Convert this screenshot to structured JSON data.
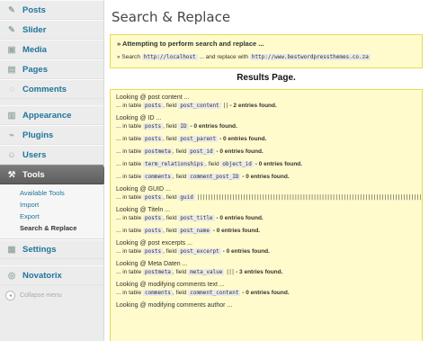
{
  "sidebar": {
    "items_top": [
      {
        "label": "Posts",
        "icon": "pin-icon"
      },
      {
        "label": "Slider",
        "icon": "pin-icon"
      },
      {
        "label": "Media",
        "icon": "media-icon"
      },
      {
        "label": "Pages",
        "icon": "page-icon"
      },
      {
        "label": "Comments",
        "icon": "comment-icon"
      }
    ],
    "items_mid": [
      {
        "label": "Appearance",
        "icon": "appearance-icon"
      },
      {
        "label": "Plugins",
        "icon": "plugin-icon"
      },
      {
        "label": "Users",
        "icon": "users-icon"
      }
    ],
    "tools": {
      "label": "Tools",
      "icon": "wrench-icon"
    },
    "submenu": [
      "Available Tools",
      "Import",
      "Export",
      "Search & Replace"
    ],
    "items_bottom": [
      {
        "label": "Settings",
        "icon": "settings-icon"
      }
    ],
    "items_last": [
      {
        "label": "Novatorix",
        "icon": "novatorix-icon"
      }
    ],
    "collapse_label": "Collapse menu"
  },
  "main": {
    "title": "Search & Replace",
    "attempt": {
      "heading": "» Attempting to perform search and replace ...",
      "search_prefix": "» Search",
      "search_value": "http://localhost",
      "replace_prefix": "... and replace with",
      "replace_value": "http://www.bestwordpressthemes.co.za"
    },
    "results_title": "Results Page.",
    "groups": [
      {
        "label": "Looking @ post content ...",
        "lines": [
          {
            "table": "posts",
            "field": "post_content",
            "bars": "||",
            "count": "- 2 entries found."
          }
        ]
      },
      {
        "label": "Looking @ ID ...",
        "lines": [
          {
            "table": "posts",
            "field": "ID",
            "bars": "",
            "count": "- 0 entries found."
          },
          {
            "table": "posts",
            "field": "post_parent",
            "bars": "",
            "count": "- 0 entries found."
          },
          {
            "table": "postmeta",
            "field": "post_id",
            "bars": "",
            "count": "- 0 entries found."
          },
          {
            "table": "term_relationships",
            "field": "object_id",
            "bars": "",
            "count": "- 0 entries found."
          },
          {
            "table": "comments",
            "field": "comment_post_ID",
            "bars": "",
            "count": "- 0 entries found."
          }
        ]
      },
      {
        "label": "Looking @ GUID ...",
        "lines": [
          {
            "table": "posts",
            "field": "guid",
            "bars": "||||||||||||||||||||||||||||||||||||||||||||||||||||||||||||||||||||||||||||||||||||||||||",
            "count": ""
          }
        ]
      },
      {
        "label": "Looking @ Titeln ...",
        "lines": [
          {
            "table": "posts",
            "field": "post_title",
            "bars": "",
            "count": "- 0 entries found."
          },
          {
            "table": "posts",
            "field": "post_name",
            "bars": "",
            "count": "- 0 entries found."
          }
        ]
      },
      {
        "label": "Looking @ post excerpts ...",
        "lines": [
          {
            "table": "posts",
            "field": "post_excerpt",
            "bars": "",
            "count": "- 0 entries found."
          }
        ]
      },
      {
        "label": "Looking @ Meta Daten ...",
        "lines": [
          {
            "table": "postmeta",
            "field": "meta_value",
            "bars": "|||",
            "count": "- 3 entries found."
          }
        ]
      },
      {
        "label": "Looking @ modifying comments text ...",
        "lines": [
          {
            "table": "comments",
            "field": "comment_content",
            "bars": "",
            "count": "- 0 entries found."
          }
        ]
      },
      {
        "label": "Looking @ modifying comments author ...",
        "lines": []
      }
    ],
    "in_table": "... in table",
    "field_word": ", field"
  },
  "colors": {
    "link": "#21759b",
    "notice_bg": "#fffbcc",
    "notice_border": "#e6db55",
    "tools_bg": "#6a6a6a"
  }
}
